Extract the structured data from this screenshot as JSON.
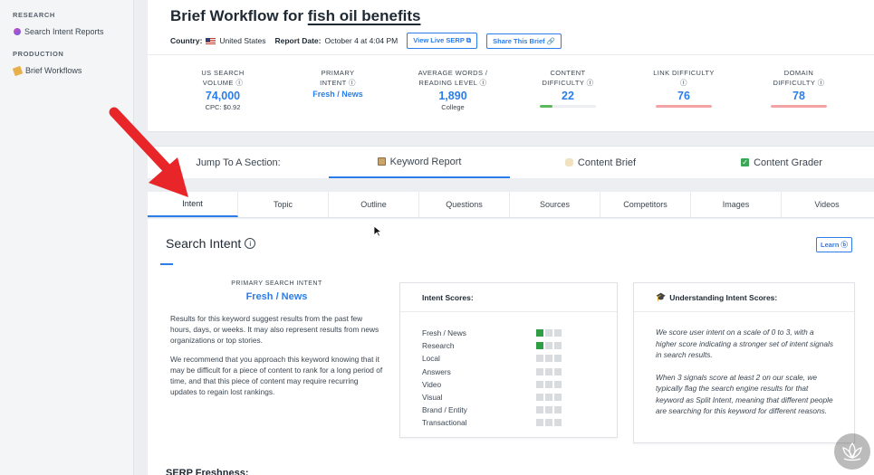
{
  "sidebar": {
    "sections": [
      {
        "heading": "RESEARCH",
        "items": [
          {
            "label": "Search Intent Reports",
            "icon": "gem-icon"
          }
        ]
      },
      {
        "heading": "PRODUCTION",
        "items": [
          {
            "label": "Brief Workflows",
            "icon": "pencil-icon"
          }
        ]
      }
    ]
  },
  "header": {
    "title_prefix": "Brief Workflow for",
    "keyword": "fish oil benefits",
    "country_label": "Country:",
    "country_value": "United States",
    "report_date_label": "Report Date:",
    "report_date_value": "October 4 at 4:04 PM",
    "view_serp_button": "View Live SERP ⧉",
    "share_button": "Share This Brief 🔗"
  },
  "stats": [
    {
      "label": "US Search Volume ⓘ",
      "value": "74,000",
      "sub": "CPC: $0.92"
    },
    {
      "label": "Primary Intent ⓘ",
      "value": "Fresh / News",
      "sub": ""
    },
    {
      "label": "Average Words / Reading Level ⓘ",
      "value": "1,890",
      "sub": "College"
    },
    {
      "label": "Content Difficulty ⓘ",
      "value": "22",
      "bar_percent": 22,
      "bar_color": "#5cb85c"
    },
    {
      "label": "Link Difficulty ⓘ",
      "value": "76",
      "bar_percent": 100,
      "bar_color": "#f2a3a3"
    },
    {
      "label": "Domain Difficulty ⓘ",
      "value": "78",
      "bar_percent": 100,
      "bar_color": "#f2a3a3"
    }
  ],
  "jump": {
    "label": "Jump To A Section:",
    "tabs": [
      {
        "label": "Keyword Report",
        "icon": "notepad-icon",
        "active": true
      },
      {
        "label": "Content Brief",
        "icon": "scroll-icon",
        "active": false
      },
      {
        "label": "Content Grader",
        "icon": "checkbox-icon",
        "active": false
      }
    ]
  },
  "tabs": [
    "Intent",
    "Topic",
    "Outline",
    "Questions",
    "Sources",
    "Competitors",
    "Images",
    "Videos"
  ],
  "intent": {
    "title": "Search Intent",
    "learn_button": "Learn ⓑ",
    "primary_label": "PRIMARY SEARCH INTENT",
    "primary_value": "Fresh / News",
    "para1": "Results for this keyword suggest results from the past few hours, days, or weeks. It may also represent results from news organizations or top stories.",
    "para2": "We recommend that you approach this keyword knowing that it may be difficult for a piece of content to rank for a long period of time, and that this piece of content may require recurring updates to regain lost rankings.",
    "scores_title": "Intent Scores:",
    "scores": [
      {
        "name": "Fresh / News",
        "score": 1
      },
      {
        "name": "Research",
        "score": 1
      },
      {
        "name": "Local",
        "score": 0
      },
      {
        "name": "Answers",
        "score": 0
      },
      {
        "name": "Video",
        "score": 0
      },
      {
        "name": "Visual",
        "score": 0
      },
      {
        "name": "Brand / Entity",
        "score": 0
      },
      {
        "name": "Transactional",
        "score": 0
      }
    ],
    "understanding_title": "Understanding Intent Scores:",
    "understanding_p1": "We score user intent on a scale of 0 to 3, with a higher score indicating a stronger set of intent signals in search results.",
    "understanding_p2": "When 3 signals score at least 2 on our scale, we typically flag the search engine results for that keyword as Split Intent, meaning that different people are searching for this keyword for different reasons.",
    "serp_freshness": "SERP Freshness:"
  },
  "colors": {
    "accent": "#2b7de9",
    "check": "#2f9e44",
    "arrow": "#e8262a"
  }
}
